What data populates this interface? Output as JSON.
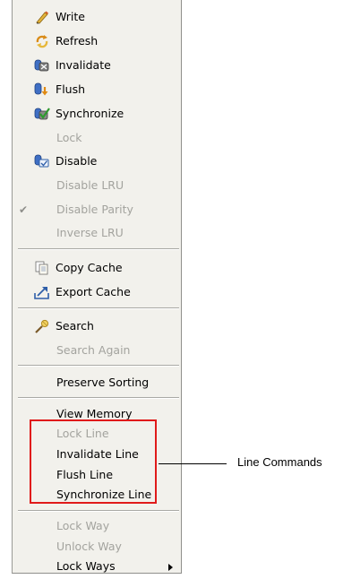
{
  "menu": {
    "write": "Write",
    "refresh": "Refresh",
    "invalidate": "Invalidate",
    "flush": "Flush",
    "synchronize": "Synchronize",
    "lock": "Lock",
    "disable": "Disable",
    "disable_lru": "Disable LRU",
    "disable_parity": "Disable Parity",
    "inverse_lru": "Inverse LRU",
    "copy_cache": "Copy Cache",
    "export_cache": "Export Cache",
    "search": "Search",
    "search_again": "Search Again",
    "preserve_sorting": "Preserve Sorting",
    "view_memory": "View Memory",
    "lock_line": "Lock Line",
    "invalidate_line": "Invalidate Line",
    "flush_line": "Flush Line",
    "synchronize_line": "Synchronize Line",
    "lock_way": "Lock Way",
    "unlock_way": "Unlock Way",
    "lock_ways": "Lock Ways",
    "check_glyph": "✔"
  },
  "callout": {
    "label": "Line Commands",
    "color": "#e01a1a"
  }
}
